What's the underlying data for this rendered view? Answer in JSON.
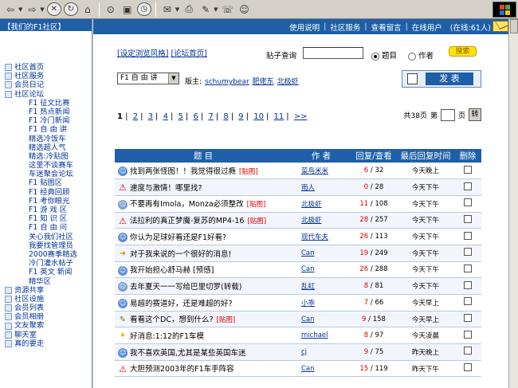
{
  "toolbar": {
    "icons": [
      "back-icon",
      "forward-icon",
      "stop-icon",
      "refresh-icon",
      "home-icon",
      "search-icon",
      "favorites-icon",
      "history-icon",
      "mail-icon",
      "print-icon",
      "edit-icon",
      "discuss-icon"
    ]
  },
  "sidebar": {
    "title": "【我们的F1社区】",
    "groups": [
      {
        "label": "社区首页"
      },
      {
        "label": "社区服务"
      },
      {
        "label": "会员日记"
      },
      {
        "label": "社区论坛"
      }
    ],
    "items": [
      "F1 征文比赛",
      "F1 热点新闻",
      "F1 冷门新闻",
      "F1 自 由 讲",
      "精选冷饭车",
      "精选超人气",
      "精选:冷贴图",
      "这里不谈赛车",
      "车迷聚会论坛",
      "F1 贴图区",
      "F1 经典回顾",
      "F1 考你眼光",
      "F1 游 戏 区",
      "F1 知 识 区",
      "F1 自 由 问",
      "关心我们社区",
      "我要找管理员",
      "2000赛季精选",
      "冷门灌水帖子",
      "F1 英文 新闻",
      "精华区"
    ],
    "bottom": [
      "资源共享",
      "社区设施",
      "会员列表",
      "会员相册",
      "文友聚索",
      "聊天室",
      "真的要走"
    ]
  },
  "topnav": {
    "links": [
      "使用说明",
      "社区服务",
      "查看留言",
      "在线用户"
    ],
    "online": "(在线:61人)"
  },
  "search": {
    "prefs_label": "[设定浏览风格]",
    "home_label": "[论坛首页]",
    "label": "贴子查询",
    "opt_title": "题目",
    "opt_author": "作者",
    "button": "搜索"
  },
  "forum": {
    "select": "F1 自 由 讲",
    "mod_label": "版主:",
    "mods": [
      "schumybear",
      "肥佬东",
      "北极虾"
    ],
    "post_button": "发 表"
  },
  "pager": {
    "current": "1",
    "pages": [
      "2",
      "3",
      "4",
      "5",
      "6",
      "7",
      "8",
      "9",
      "10",
      "11",
      ">>"
    ],
    "total_label": "共38页",
    "goto_label": "第",
    "page_unit": "页",
    "goto_button": "转"
  },
  "table": {
    "headers": [
      "题 目",
      "作 者",
      "回复/查看",
      "最后回复时间",
      "删除"
    ],
    "rows": [
      {
        "icon": "smile",
        "title": "找到两张怪图！！我觉得很过瘾",
        "tag": "[贴图]",
        "author": "菜鸟米米",
        "replies": "6",
        "views": "32",
        "time": "今天晚上"
      },
      {
        "icon": "warn",
        "title": "速度与激情！哪里找?",
        "tag": "",
        "author": "雨人",
        "replies": "0",
        "views": "28",
        "time": "今天下午"
      },
      {
        "icon": "sad",
        "title": "不要再有Imola，Monza必须整改",
        "tag": "[贴图]",
        "author": "北极虾",
        "replies": "11",
        "views": "108",
        "time": "今天下午"
      },
      {
        "icon": "warn",
        "title": "法拉利的真正梦魔-复苏的MP4-16",
        "tag": "[贴图]",
        "author": "北极虾",
        "replies": "28",
        "views": "257",
        "time": "今天下午"
      },
      {
        "icon": "smile",
        "title": "你认为足球好看还是F1好看?",
        "tag": "",
        "author": "现代车夫",
        "replies": "26",
        "views": "113",
        "time": "今天下午"
      },
      {
        "icon": "arrow",
        "title": "对于我来说的一个很好的消息!",
        "tag": "",
        "author": "Can",
        "replies": "19",
        "views": "249",
        "time": "今天下午"
      },
      {
        "icon": "smile",
        "title": "我开始担心舒马赫 [预感]",
        "tag": "",
        "author": "Can",
        "replies": "26",
        "views": "288",
        "time": "今天下午"
      },
      {
        "icon": "sad",
        "title": "去年夏天一一写给巴里切罗(转载)",
        "tag": "",
        "author": "乱虹",
        "replies": "8",
        "views": "81",
        "time": "今天下午"
      },
      {
        "icon": "smile",
        "title": "易超的赛道好，还是难超的好?",
        "tag": "",
        "author": "小乖",
        "replies": "7",
        "views": "66",
        "time": "今天早上"
      },
      {
        "icon": "pencil",
        "title": "看看这个DC，想到什么?",
        "tag": "[贴图]",
        "author": "Can",
        "replies": "9",
        "views": "158",
        "time": "今天早上"
      },
      {
        "icon": "bulb",
        "title": "好消息:1:12的F1车模",
        "tag": "",
        "author": "michael",
        "replies": "8",
        "views": "97",
        "time": "今天凌晨"
      },
      {
        "icon": "smile",
        "title": "我不喜欢英国,尤其是某些英国车迷",
        "tag": "",
        "author": "cj",
        "replies": "9",
        "views": "75",
        "time": "昨天晚上"
      },
      {
        "icon": "warn",
        "title": "大胆预测2003年的F1车手阵容",
        "tag": "",
        "author": "Can",
        "replies": "15",
        "views": "119",
        "time": "昨天下午"
      }
    ]
  }
}
